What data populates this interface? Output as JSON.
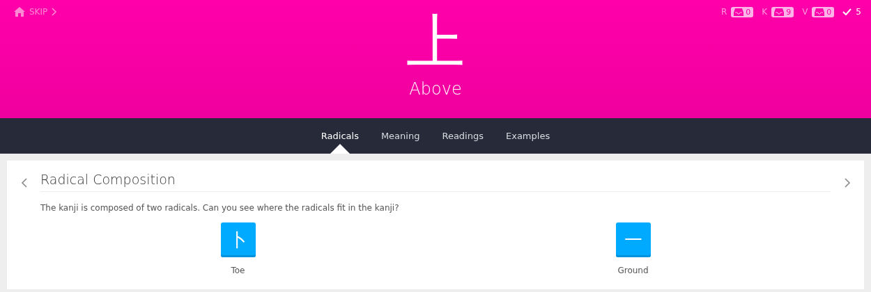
{
  "header": {
    "skip_label": "SKIP",
    "character": "上",
    "meaning": "Above",
    "counters": [
      {
        "letter": "R",
        "count": "0"
      },
      {
        "letter": "K",
        "count": "9"
      },
      {
        "letter": "V",
        "count": "0"
      }
    ],
    "done_count": "5"
  },
  "tabs": [
    {
      "label": "Radicals",
      "selected": true
    },
    {
      "label": "Meaning",
      "selected": false
    },
    {
      "label": "Readings",
      "selected": false
    },
    {
      "label": "Examples",
      "selected": false
    }
  ],
  "section": {
    "title": "Radical Composition",
    "description": "The kanji is composed of two radicals. Can you see where the radicals fit in the kanji?",
    "radicals": [
      {
        "character": "卜",
        "name": "Toe"
      },
      {
        "character": "一",
        "name": "Ground"
      }
    ]
  }
}
